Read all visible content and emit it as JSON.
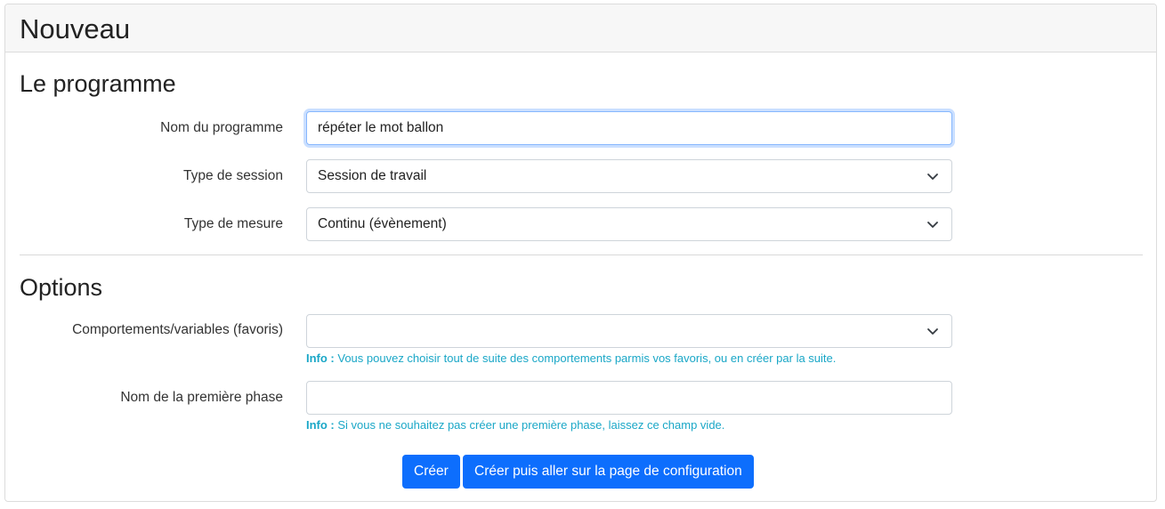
{
  "header": {
    "title": "Nouveau"
  },
  "section_program": {
    "title": "Le programme",
    "name_label": "Nom du programme",
    "name_value": "répéter le mot ballon",
    "session_label": "Type de session",
    "session_value": "Session de travail",
    "measure_label": "Type de mesure",
    "measure_value": "Continu (évènement)"
  },
  "section_options": {
    "title": "Options",
    "behaviors_label": "Comportements/variables (favoris)",
    "behaviors_value": "",
    "behaviors_help_prefix": "Info :",
    "behaviors_help_text": " Vous pouvez choisir tout de suite des comportements parmis vos favoris, ou en créer par la suite.",
    "phase_label": "Nom de la première phase",
    "phase_value": "",
    "phase_help_prefix": "Info :",
    "phase_help_text": " Si vous ne souhaitez pas créer une première phase, laissez ce champ vide."
  },
  "buttons": {
    "create": "Créer",
    "create_configure": "Créer puis aller sur la page de configuration"
  },
  "colors": {
    "primary": "#0d6efd",
    "info": "#1aa7c7"
  },
  "icons": {
    "select_caret": "chevron-down-icon"
  }
}
